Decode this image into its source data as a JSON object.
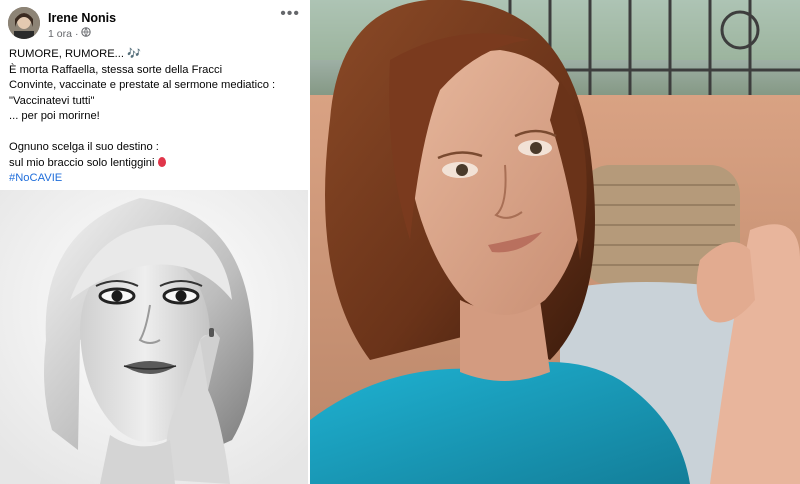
{
  "post": {
    "author": "Irene Nonis",
    "time": "1 ora",
    "audience_icon": "globe-icon",
    "more_icon": "more-options-icon",
    "lines": [
      "RUMORE, RUMORE... 🎶",
      "È morta Raffaella, stessa sorte della Fracci",
      "Convinte, vaccinate e prestate al sermone mediatico :",
      "\"Vaccinatevi tutti\"",
      "... per poi morirne!",
      "",
      "Ognuno scelga il suo destino :",
      "sul mio braccio solo lentiggini"
    ],
    "hashtag": "#NoCAVIE"
  },
  "colors": {
    "hashtag": "#216fdb",
    "author": "#050505",
    "meta": "#65676b",
    "shirt": "#1ca3c4",
    "hair": "#7a3a1e"
  }
}
